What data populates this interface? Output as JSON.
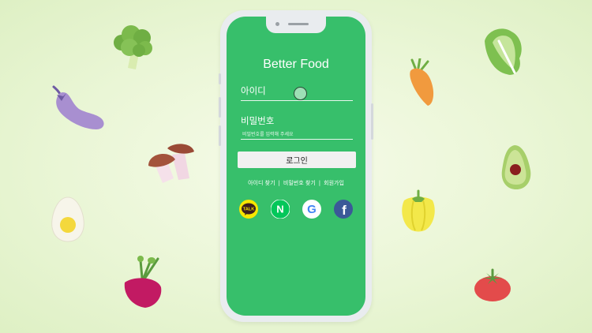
{
  "app": {
    "title": "Better Food"
  },
  "login_form": {
    "id_label": "아이디",
    "password_label": "비밀번호",
    "password_placeholder": "비밀번호를 입력해 주세요",
    "login_button": "로그인"
  },
  "links": {
    "find_id": "아이디 찾기",
    "find_password": "비밀번호 찾기",
    "signup": "회원가입",
    "separator": "|"
  },
  "social_login": [
    {
      "name": "kakao",
      "icon": "kakao-talk-icon",
      "text": "TALK",
      "color": "#f7e600"
    },
    {
      "name": "naver",
      "icon": "naver-icon",
      "text": "N",
      "color": "#03c75a"
    },
    {
      "name": "google",
      "icon": "google-icon",
      "text": "G",
      "color": "#ffffff"
    },
    {
      "name": "facebook",
      "icon": "facebook-icon",
      "text": "f",
      "color": "#3b5998"
    }
  ],
  "colors": {
    "screen": "#37bf6b",
    "background": "#eaf6d6",
    "button": "#f1f1f1"
  },
  "decorations": [
    "broccoli-icon",
    "eggplant-icon",
    "mushroom-icon",
    "egg-icon",
    "beet-icon",
    "carrot-icon",
    "lettuce-icon",
    "avocado-icon",
    "bell-pepper-icon",
    "tomato-icon"
  ]
}
